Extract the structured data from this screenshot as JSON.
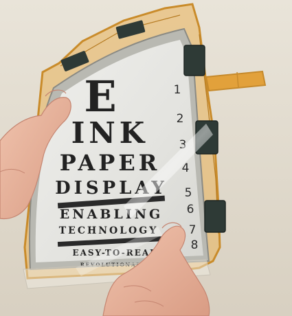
{
  "eye_chart": {
    "rows": [
      {
        "text": "E",
        "number": "1"
      },
      {
        "text": "INK",
        "number": "2"
      },
      {
        "text": "PAPER",
        "number": "3"
      },
      {
        "text": "DISPLAY",
        "number": "4"
      },
      {
        "text": "ENABLING",
        "number": "5"
      },
      {
        "text": "TECHNOLOGY",
        "number": "6"
      },
      {
        "text": "EASY-TO-READ",
        "number": "8"
      },
      {
        "text": "REVOLUTIONARY",
        "number": ""
      }
    ],
    "extra_number": "7"
  },
  "colors": {
    "background_wall": "#e3ddd0",
    "display_surface": "#e6e6e2",
    "flex_cable": "#e0a23a",
    "skin": "#e8b59e",
    "ink": "#222222",
    "connector": "#2e3a36"
  },
  "icons": {
    "connector_top": "flex-connector-icon",
    "connector_mid": "flex-connector-icon",
    "connector_bottom": "flex-connector-icon"
  }
}
